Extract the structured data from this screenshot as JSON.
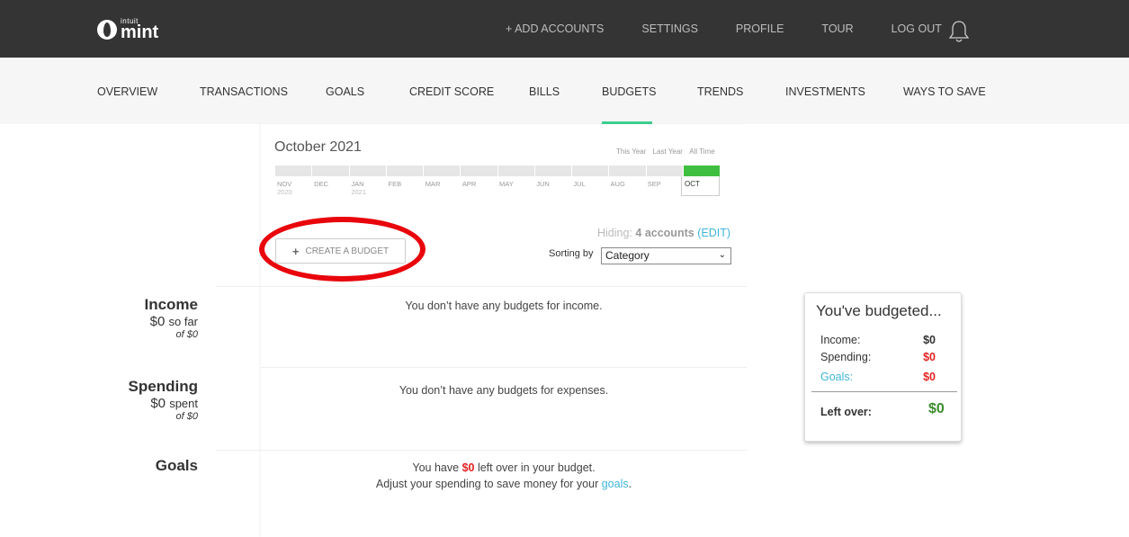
{
  "brand": {
    "intuit": "intuit",
    "mint": "mint"
  },
  "topbar": {
    "links": [
      "+ ADD ACCOUNTS",
      "SETTINGS",
      "PROFILE",
      "TOUR",
      "LOG OUT"
    ]
  },
  "nav": {
    "items": [
      "OVERVIEW",
      "TRANSACTIONS",
      "GOALS",
      "CREDIT SCORE",
      "BILLS",
      "BUDGETS",
      "TRENDS",
      "INVESTMENTS",
      "WAYS TO SAVE"
    ],
    "active": "BUDGETS"
  },
  "period": {
    "title": "October 2021",
    "range_links": [
      "This Year",
      "Last Year",
      "All Time"
    ],
    "months": [
      {
        "m": "NOV",
        "y": "2020"
      },
      {
        "m": "DEC",
        "y": ""
      },
      {
        "m": "JAN",
        "y": "2021"
      },
      {
        "m": "FEB",
        "y": ""
      },
      {
        "m": "MAR",
        "y": ""
      },
      {
        "m": "APR",
        "y": ""
      },
      {
        "m": "MAY",
        "y": ""
      },
      {
        "m": "JUN",
        "y": ""
      },
      {
        "m": "JUL",
        "y": ""
      },
      {
        "m": "AUG",
        "y": ""
      },
      {
        "m": "SEP",
        "y": ""
      }
    ],
    "current_month": "OCT"
  },
  "actions": {
    "create_budget": "CREATE A BUDGET",
    "plus": "+"
  },
  "hiding": {
    "prefix": "Hiding:",
    "count": "4 accounts",
    "edit": "(EDIT)"
  },
  "sorting": {
    "label": "Sorting by",
    "value": "Category"
  },
  "sections": {
    "income": {
      "title": "Income",
      "amount": "$0",
      "suffix": "so far",
      "of": "of $0",
      "message": "You don’t have any budgets for income."
    },
    "spending": {
      "title": "Spending",
      "amount": "$0",
      "suffix": "spent",
      "of": "of $0",
      "message": "You don’t have any budgets for expenses."
    },
    "goals": {
      "title": "Goals",
      "msg1_pre": "You have",
      "msg1_amount": "$0",
      "msg1_post": "left over in your budget.",
      "msg2_pre": "Adjust your spending to save money for your",
      "msg2_link": "goals",
      "msg2_post": "."
    }
  },
  "summary": {
    "title": "You've budgeted...",
    "income_label": "Income:",
    "income_value": "$0",
    "spending_label": "Spending:",
    "spending_value": "$0",
    "goals_label": "Goals:",
    "goals_value": "$0",
    "leftover_label": "Left over:",
    "leftover_value": "$0"
  },
  "colors": {
    "accent_green": "#3ecf8e",
    "timeline_current": "#3fbf3f",
    "red": "#e52222",
    "link": "#3fb5d8",
    "highlight": "#e8050b"
  }
}
